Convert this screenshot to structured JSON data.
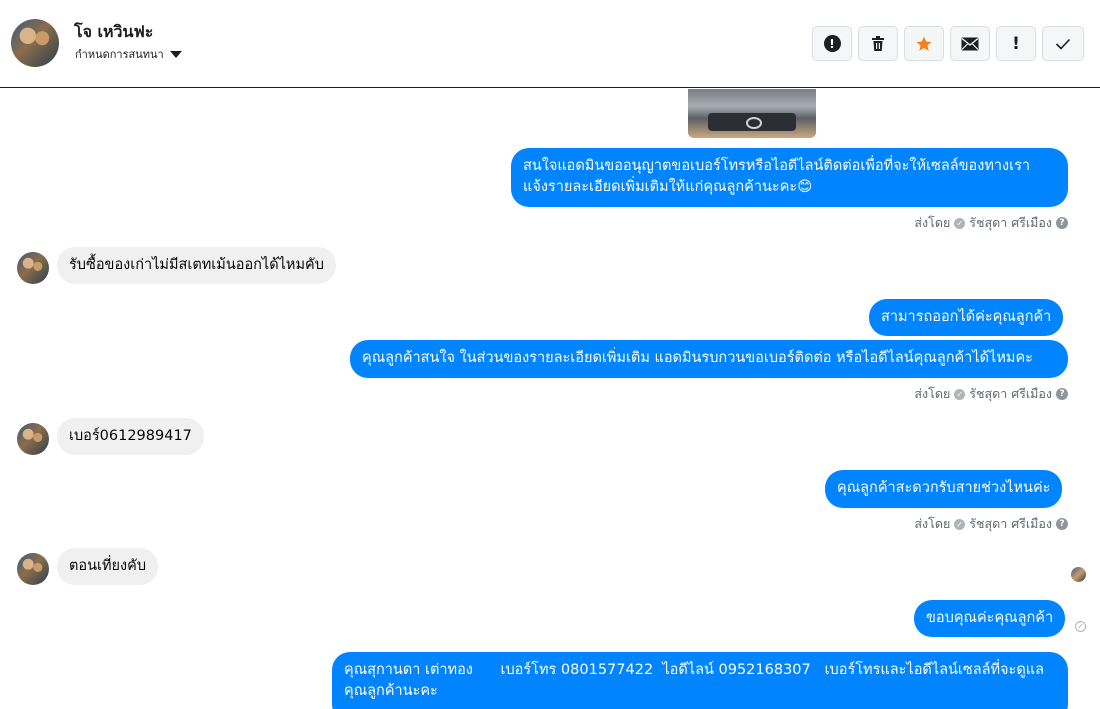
{
  "header": {
    "contact_name": "โจ เหวินฟะ",
    "assign_label": "กำหนดการสนทนา",
    "actions": [
      {
        "icon": "alert-circle-icon",
        "glyph": "!"
      },
      {
        "icon": "trash-icon",
        "glyph": ""
      },
      {
        "icon": "star-icon",
        "glyph": "★"
      },
      {
        "icon": "envelope-icon",
        "glyph": "✉"
      },
      {
        "icon": "exclamation-icon",
        "glyph": "!"
      },
      {
        "icon": "checkmark-icon",
        "glyph": "✓"
      }
    ]
  },
  "messages": {
    "m1": "สนใจแอดมินขออนุญาตขอเบอร์โทรหรือไอดีไลน์ติดต่อเพื่อที่จะให้เซลล์ของทางเรา",
    "m1b": "แจ้งรายละเอียดเพิ่มเติมให้แก่คุณลูกค้านะคะ😊",
    "m2": "รับซื้อของเก่าไม่มีสเตทเม้นออกได้ไหมคับ",
    "m3": "สามารถออกได้ค่ะคุณลูกค้า",
    "m4": "คุณลูกค้าสนใจ ในส่วนของรายละเอียดเพิ่มเติม แอดมินรบกวนขอเบอร์ติดต่อ หรือไอดีไลน์คุณลูกค้าได้ไหมคะ",
    "m5": "เบอร์0612989417",
    "m6": "คุณลูกค้าสะดวกรับสายช่วงไหนค่ะ",
    "m7": "ตอนเที่ยงคับ",
    "m8": "ขอบคุณค่ะคุณลูกค้า",
    "m9": "คุณสุกานดา เต่าทอง      เบอร์โทร 0801577422  ไอดีไลน์ 0952168307   เบอร์โทรและไอดีไลน์เซลล์ที่จะดูแล",
    "m9b": "คุณลูกค้านะคะ"
  },
  "sent_by": {
    "prefix": "ส่งโดย",
    "agent": "รัชสุดา ศรีเมือง"
  },
  "colors": {
    "outgoing": "#0084ff",
    "incoming": "#f0f0f0",
    "star": "#f5821f"
  }
}
